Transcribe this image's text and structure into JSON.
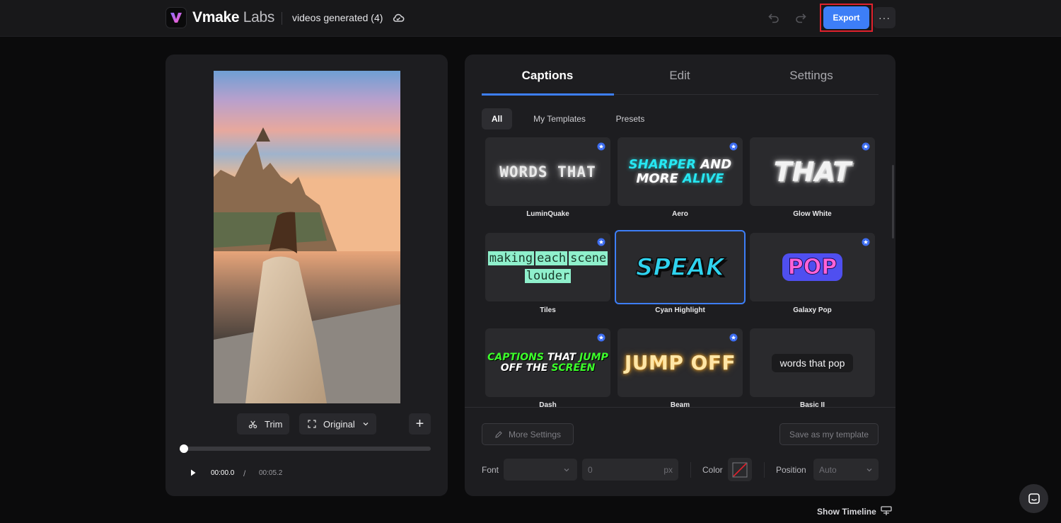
{
  "header": {
    "brand_bold": "Vmake",
    "brand_light": " Labs",
    "project_name": "videos generated (4)",
    "export_label": "Export",
    "more_label": "···"
  },
  "player": {
    "trim_label": "Trim",
    "aspect_label": "Original",
    "add_label": "+",
    "current_time": "00:00.0",
    "separator": "/",
    "total_time": "00:05.2",
    "progress": 0
  },
  "tabs": [
    {
      "label": "Captions",
      "active": true
    },
    {
      "label": "Edit",
      "active": false
    },
    {
      "label": "Settings",
      "active": false
    }
  ],
  "filters": [
    {
      "label": "All",
      "active": true
    },
    {
      "label": "My Templates",
      "active": false
    },
    {
      "label": "Presets",
      "active": false
    }
  ],
  "templates": [
    {
      "name": "LuminQuake",
      "preview": [
        "WORDS",
        "THAT"
      ],
      "premium": true,
      "selected": false
    },
    {
      "name": "Aero",
      "preview": [
        "SHARPER",
        "AND",
        "MORE",
        "ALIVE"
      ],
      "premium": true,
      "selected": false
    },
    {
      "name": "Glow White",
      "preview": [
        "THAT"
      ],
      "premium": true,
      "selected": false
    },
    {
      "name": "Tiles",
      "preview": [
        "making",
        "each",
        "scene",
        "louder"
      ],
      "premium": true,
      "selected": false
    },
    {
      "name": "Cyan Highlight",
      "preview": [
        "SPEAK"
      ],
      "premium": false,
      "selected": true
    },
    {
      "name": "Galaxy Pop",
      "preview": [
        "POP"
      ],
      "premium": true,
      "selected": false
    },
    {
      "name": "Dash",
      "preview": [
        "CAPTIONS",
        "THAT",
        "JUMP",
        "OFF THE",
        "SCREEN"
      ],
      "premium": true,
      "selected": false
    },
    {
      "name": "Beam",
      "preview": [
        "JUMP OFF"
      ],
      "premium": true,
      "selected": false
    },
    {
      "name": "Basic II",
      "preview": [
        "words that pop"
      ],
      "premium": false,
      "selected": false
    }
  ],
  "controls": {
    "more_settings_label": "More Settings",
    "save_template_label": "Save as my template",
    "font_label": "Font",
    "font_value": "",
    "size_value": "0",
    "size_unit": "px",
    "color_label": "Color",
    "position_label": "Position",
    "position_value": "Auto"
  },
  "footer": {
    "show_timeline_label": "Show Timeline"
  },
  "colors": {
    "accent": "#3d7ef7",
    "highlight_outline": "#e1222d",
    "panel_bg": "#1d1d20"
  }
}
